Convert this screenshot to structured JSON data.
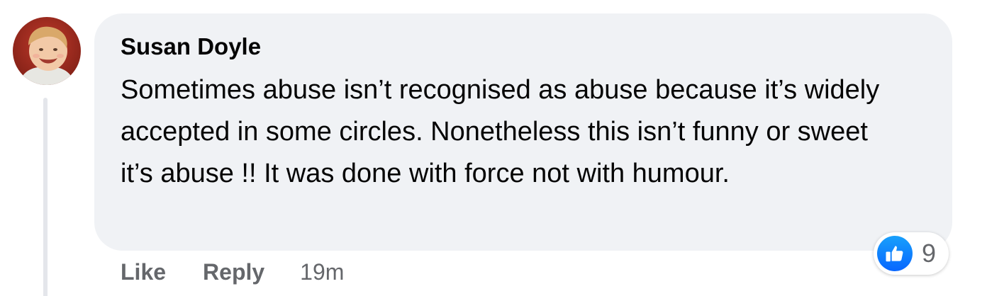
{
  "comment": {
    "author": "Susan Doyle",
    "avatar_icon": "child-portrait-avatar",
    "text": "Sometimes abuse isn’t recognised as abuse because it’s widely accepted in some circles. Nonetheless this isn’t funny or sweet it’s abuse !! It was done with force not with humour.",
    "reactions": {
      "icon": "thumbs-up-icon",
      "count": "9",
      "color": "#0866ff"
    },
    "actions": {
      "like_label": "Like",
      "reply_label": "Reply",
      "timestamp": "19m"
    }
  },
  "colors": {
    "bubble_background": "#f0f2f5",
    "secondary_text": "#65676b",
    "primary_text": "#050505"
  }
}
